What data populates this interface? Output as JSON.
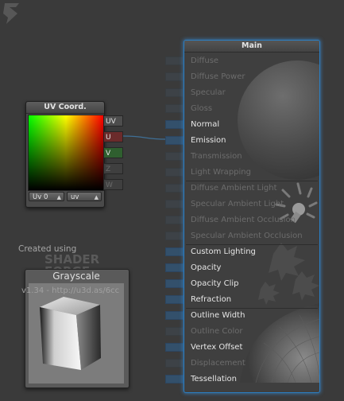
{
  "uv_node": {
    "title": "UV Coord.",
    "outputs": [
      {
        "label": "UV",
        "bg": "#4d4d4d",
        "color": "#e6e6e6"
      },
      {
        "label": "U",
        "bg": "#6b2b2b",
        "color": "#e6e6e6"
      },
      {
        "label": "V",
        "bg": "#2f5f2f",
        "color": "#e6e6e6"
      },
      {
        "label": "Z",
        "bg": "#3f3f3f",
        "color": "#6a6a6a"
      },
      {
        "label": "W",
        "bg": "#3f3f3f",
        "color": "#6a6a6a"
      }
    ],
    "uv_channel": "Uv 0",
    "uv_mode": "uv"
  },
  "branding": {
    "created_using": "Created using",
    "logo_top": "SHADER",
    "logo_bottom": "FORGE",
    "version": "v1.34 - http://u3d.as/6cc"
  },
  "grayscale_node": {
    "title": "Grayscale"
  },
  "main_node": {
    "title": "Main",
    "accent": "#2a7fc4",
    "inputs": [
      {
        "label": "Diffuse",
        "active": false
      },
      {
        "label": "Diffuse Power",
        "active": false
      },
      {
        "label": "Specular",
        "active": false
      },
      {
        "label": "Gloss",
        "active": false
      },
      {
        "label": "Normal",
        "active": true
      },
      {
        "label": "Emission",
        "active": true,
        "connected": true
      },
      {
        "label": "Transmission",
        "active": false
      },
      {
        "label": "Light Wrapping",
        "active": false
      },
      {
        "label": "Diffuse Ambient Light",
        "active": false
      },
      {
        "label": "Specular Ambient Light",
        "active": false
      },
      {
        "label": "Diffuse Ambient Occlusion",
        "active": false
      },
      {
        "label": "Specular Ambient Occlusion",
        "active": false
      },
      {
        "label": "Custom Lighting",
        "active": true
      },
      {
        "label": "Opacity",
        "active": true
      },
      {
        "label": "Opacity Clip",
        "active": true
      },
      {
        "label": "Refraction",
        "active": true
      },
      {
        "label": "Outline Width",
        "active": true
      },
      {
        "label": "Outline Color",
        "active": false
      },
      {
        "label": "Vertex Offset",
        "active": true
      },
      {
        "label": "Displacement",
        "active": false
      },
      {
        "label": "Tessellation",
        "active": true
      }
    ]
  },
  "icons": {
    "light": "lightbulb-icon",
    "leaves": "leaf-icon",
    "sphere": "sphere-icon"
  }
}
